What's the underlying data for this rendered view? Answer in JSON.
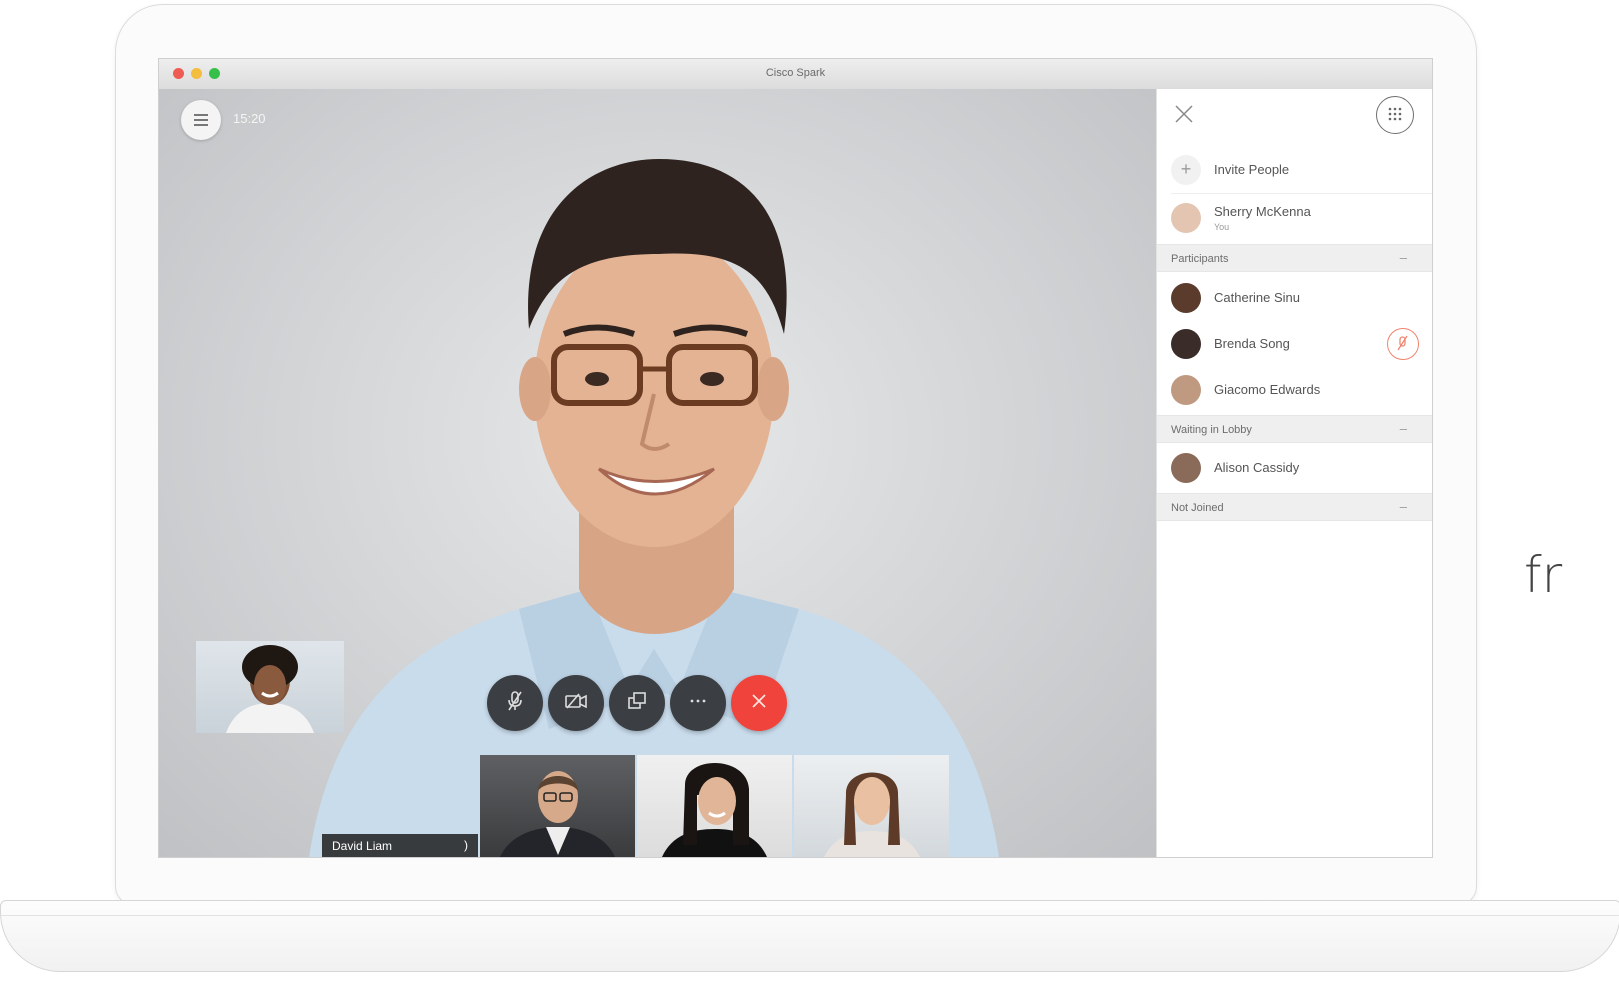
{
  "window": {
    "title": "Cisco Spark",
    "clock": "15:20"
  },
  "promo_text": "fr",
  "call": {
    "active_speaker_tag": "David Liam",
    "controls": [
      {
        "name": "mute-button",
        "icon": "mic-off-icon"
      },
      {
        "name": "video-button",
        "icon": "camera-off-icon"
      },
      {
        "name": "share-button",
        "icon": "share-screen-icon"
      },
      {
        "name": "more-button",
        "icon": "more-icon"
      },
      {
        "name": "end-call-button",
        "icon": "close-icon"
      }
    ],
    "end_call_color": "#f0433b"
  },
  "panel": {
    "invite_label": "Invite People",
    "self": {
      "name": "Sherry McKenna",
      "sub": "You"
    },
    "sections": {
      "participants": "Participants",
      "lobby": "Waiting in Lobby",
      "not_joined": "Not Joined"
    },
    "participants": [
      {
        "name": "Catherine Sinu",
        "muted": false
      },
      {
        "name": "Brenda Song",
        "muted": true
      },
      {
        "name": "Giacomo Edwards",
        "muted": false
      }
    ],
    "lobby": [
      {
        "name": "Alison Cassidy"
      }
    ],
    "collapse_glyph": "–",
    "mute_indicator_color": "#f0856f"
  }
}
